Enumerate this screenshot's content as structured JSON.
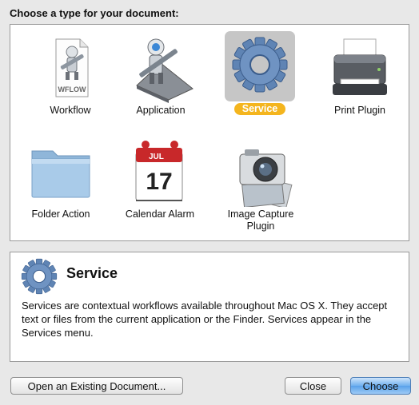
{
  "dialog": {
    "prompt": "Choose a type for your document:"
  },
  "types": [
    {
      "label": "Workflow",
      "icon": "workflow-icon"
    },
    {
      "label": "Application",
      "icon": "application-icon"
    },
    {
      "label": "Service",
      "icon": "service-gear-icon",
      "selected": true
    },
    {
      "label": "Print Plugin",
      "icon": "printer-icon"
    },
    {
      "label": "Folder Action",
      "icon": "folder-icon"
    },
    {
      "label": "Calendar Alarm",
      "icon": "calendar-icon"
    },
    {
      "label": "Image Capture Plugin",
      "icon": "camera-icon"
    }
  ],
  "workflow_badge": "WFLOW",
  "calendar": {
    "month": "JUL",
    "day": "17"
  },
  "description": {
    "title": "Service",
    "body": "Services are contextual workflows available throughout Mac OS X. They accept text or files from the current application or the Finder. Services appear in the Services menu."
  },
  "buttons": {
    "open_existing": "Open an Existing Document...",
    "close": "Close",
    "choose": "Choose"
  },
  "colors": {
    "selection_badge": "#f4b51e",
    "primary_button": "#5aa2ea"
  }
}
